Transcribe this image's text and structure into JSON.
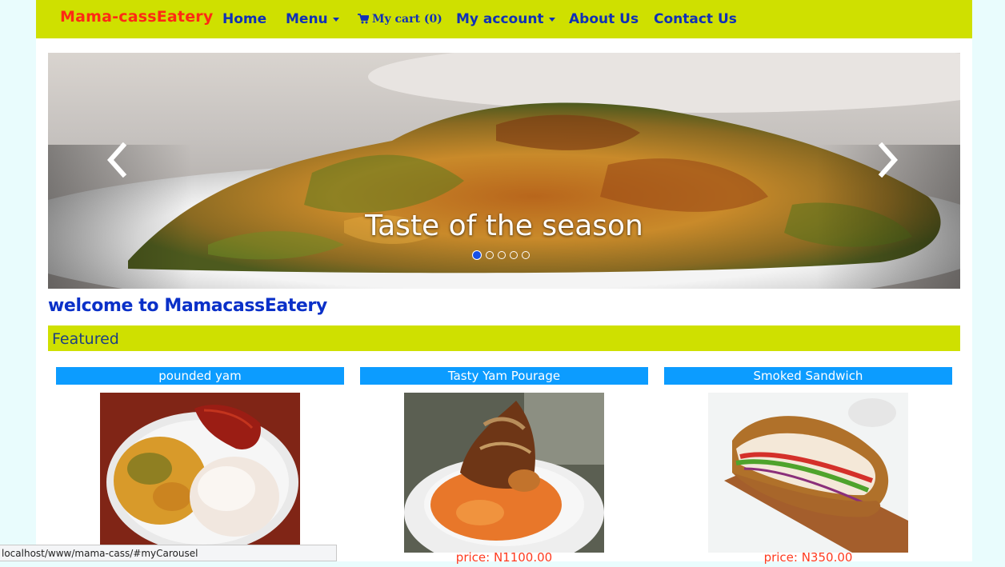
{
  "navbar": {
    "brand": "Mama-cassEatery",
    "items": [
      {
        "label": "Home"
      },
      {
        "label": "Menu"
      },
      {
        "label": "My cart (0)"
      },
      {
        "label": "My account"
      },
      {
        "label": "About Us"
      },
      {
        "label": "Contact Us"
      }
    ]
  },
  "carousel": {
    "caption": "Taste of the season",
    "slide_count": 5,
    "active_index": 0
  },
  "welcome": "welcome to MamacassEatery",
  "featured": "Featured",
  "products": [
    {
      "name": "pounded yam",
      "price": ""
    },
    {
      "name": "Tasty Yam Pourage",
      "price": "price: N1100.00"
    },
    {
      "name": "Smoked Sandwich",
      "price": "price: N350.00"
    }
  ],
  "status_bar": "localhost/www/mama-cass/#myCarousel",
  "colors": {
    "navbar": "#cfe000",
    "brand": "#ff2a14",
    "nav_text": "#1030b8",
    "product_title_bg": "#0c9cff",
    "price": "#ff3b20"
  }
}
